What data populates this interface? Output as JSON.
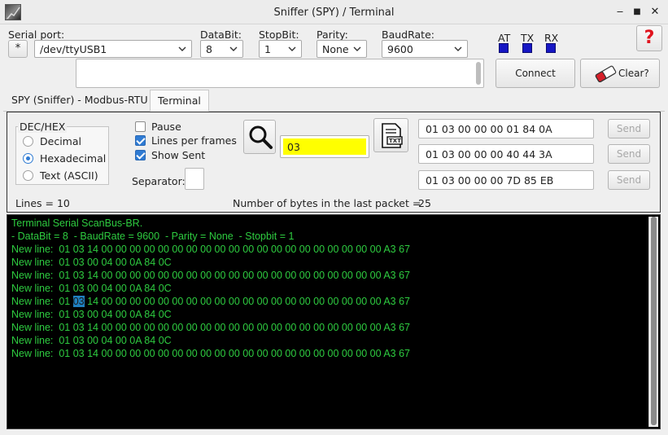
{
  "window": {
    "title": "Sniffer (SPY) / Terminal",
    "minimize_glyph": "‒",
    "maximize_glyph": "■",
    "close_glyph": "✕"
  },
  "connection": {
    "serial_port_label": "Serial port:",
    "star_button": "*",
    "serial_port_value": "/dev/ttyUSB1",
    "databit_label": "DataBit:",
    "databit_value": "8",
    "stopbit_label": "StopBit:",
    "stopbit_value": "1",
    "parity_label": "Parity:",
    "parity_value": "None",
    "baudrate_label": "BaudRate:",
    "baudrate_value": "9600",
    "status_at_label": "AT",
    "status_tx_label": "TX",
    "status_rx_label": "RX",
    "led_color": "#1717c4",
    "help_glyph": "?",
    "help_color": "#e0141e",
    "connect_label": "Connect",
    "clear_label": "Clear?",
    "message_value": ""
  },
  "tabs": [
    {
      "label": "SPY (Sniffer) - Modbus-RTU",
      "active": false
    },
    {
      "label": "Terminal",
      "active": true
    }
  ],
  "format_group": {
    "title": "DEC/HEX",
    "options": [
      {
        "label": "Decimal",
        "selected": false
      },
      {
        "label": "Hexadecimal",
        "selected": true
      },
      {
        "label": "Text (ASCII)",
        "selected": false
      }
    ]
  },
  "options": {
    "pause_label": "Pause",
    "pause_checked": false,
    "lines_per_frames_label": "Lines per frames",
    "lines_per_frames_checked": true,
    "show_sent_label": "Show Sent",
    "show_sent_checked": true,
    "separator_label": "Separator:",
    "separator_value": ""
  },
  "search": {
    "value": "03",
    "highlight_color": "#ffff00",
    "txt_icon_label": "TXT"
  },
  "send_rows": [
    {
      "value": "01 03 00 00 00 01 84 0A",
      "button": "Send"
    },
    {
      "value": "01 03 00 00 00 40 44 3A",
      "button": "Send"
    },
    {
      "value": "01 03 00 00 00 7D 85 EB",
      "button": "Send"
    }
  ],
  "stats": {
    "lines_text": "Lines = 10",
    "bytes_label": "Number of bytes in the last packet =",
    "bytes_value": "25"
  },
  "terminal": {
    "text_color": "#2ecc40",
    "background": "#000000",
    "lines": [
      {
        "pre": "Terminal Serial ScanBus-BR.",
        "hl": "",
        "post": ""
      },
      {
        "pre": "- DataBit = 8  - BaudRate = 9600  - Parity = None  - Stopbit = 1",
        "hl": "",
        "post": ""
      },
      {
        "pre": "New line:  01 03 14 00 00 00 00 00 00 00 00 00 00 00 00 00 00 00 00 00 00 00 00 A3 67",
        "hl": "",
        "post": ""
      },
      {
        "pre": "New line:  01 03 00 04 00 0A 84 0C",
        "hl": "",
        "post": ""
      },
      {
        "pre": "New line:  01 03 14 00 00 00 00 00 00 00 00 00 00 00 00 00 00 00 00 00 00 00 00 A3 67",
        "hl": "",
        "post": ""
      },
      {
        "pre": "New line:  01 03 00 04 00 0A 84 0C",
        "hl": "",
        "post": ""
      },
      {
        "pre": "New line:  01 ",
        "hl": "03",
        "post": " 14 00 00 00 00 00 00 00 00 00 00 00 00 00 00 00 00 00 00 00 00 A3 67"
      },
      {
        "pre": "New line:  01 03 00 04 00 0A 84 0C",
        "hl": "",
        "post": ""
      },
      {
        "pre": "New line:  01 03 14 00 00 00 00 00 00 00 00 00 00 00 00 00 00 00 00 00 00 00 00 A3 67",
        "hl": "",
        "post": ""
      },
      {
        "pre": "New line:  01 03 00 04 00 0A 84 0C",
        "hl": "",
        "post": ""
      },
      {
        "pre": "New line:  01 03 14 00 00 00 00 00 00 00 00 00 00 00 00 00 00 00 00 00 00 00 00 A3 67",
        "hl": "",
        "post": ""
      }
    ]
  }
}
